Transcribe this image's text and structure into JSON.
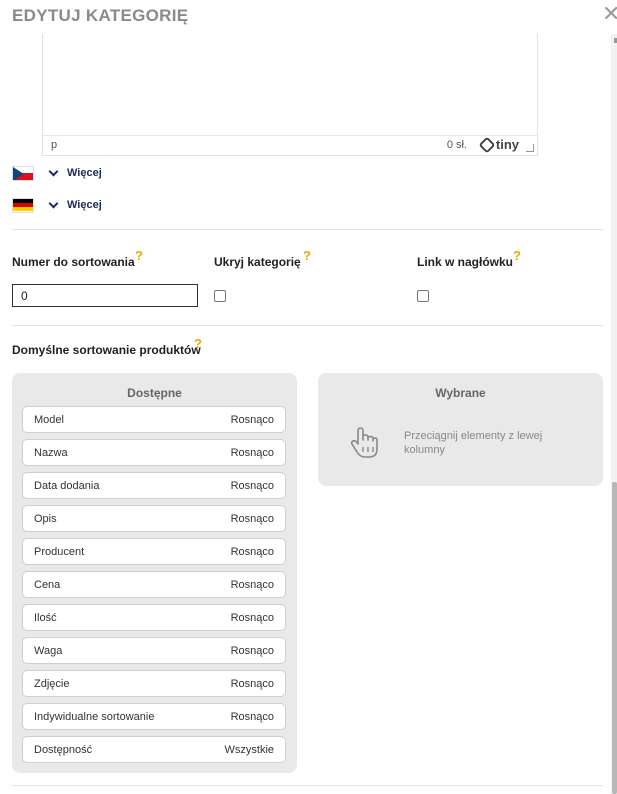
{
  "modal": {
    "title": "EDYTUJ KATEGORIĘ",
    "close_glyph": "✕"
  },
  "editor": {
    "path": "p",
    "word_count": "0 sł.",
    "brand": "tiny"
  },
  "languages": [
    {
      "flag": "cz-flag",
      "more_label": "Więcej"
    },
    {
      "flag": "de-flag",
      "more_label": "Więcej"
    }
  ],
  "fields": {
    "sort_number_label": "Numer do sortowania",
    "sort_number_value": "0",
    "hide_category_label": "Ukryj kategorię",
    "header_link_label": "Link w nagłówku",
    "help_glyph": "?"
  },
  "product_sorting": {
    "label": "Domyślne sortowanie produktów",
    "available": {
      "title": "Dostępne",
      "items": [
        {
          "name": "Model",
          "direction": "Rosnąco"
        },
        {
          "name": "Nazwa",
          "direction": "Rosnąco"
        },
        {
          "name": "Data dodania",
          "direction": "Rosnąco"
        },
        {
          "name": "Opis",
          "direction": "Rosnąco"
        },
        {
          "name": "Producent",
          "direction": "Rosnąco"
        },
        {
          "name": "Cena",
          "direction": "Rosnąco"
        },
        {
          "name": "Ilość",
          "direction": "Rosnąco"
        },
        {
          "name": "Waga",
          "direction": "Rosnąco"
        },
        {
          "name": "Zdjęcie",
          "direction": "Rosnąco"
        },
        {
          "name": "Indywidualne sortowanie",
          "direction": "Rosnąco"
        },
        {
          "name": "Dostępność",
          "direction": "Wszystkie"
        }
      ]
    },
    "selected": {
      "title": "Wybrane",
      "hint": "Przeciągnij elementy z lewej kolumny"
    }
  },
  "colors": {
    "accent_help": "#f0a800",
    "link_navy": "#1a2a5e",
    "panel_bg": "#e9e9e9"
  }
}
